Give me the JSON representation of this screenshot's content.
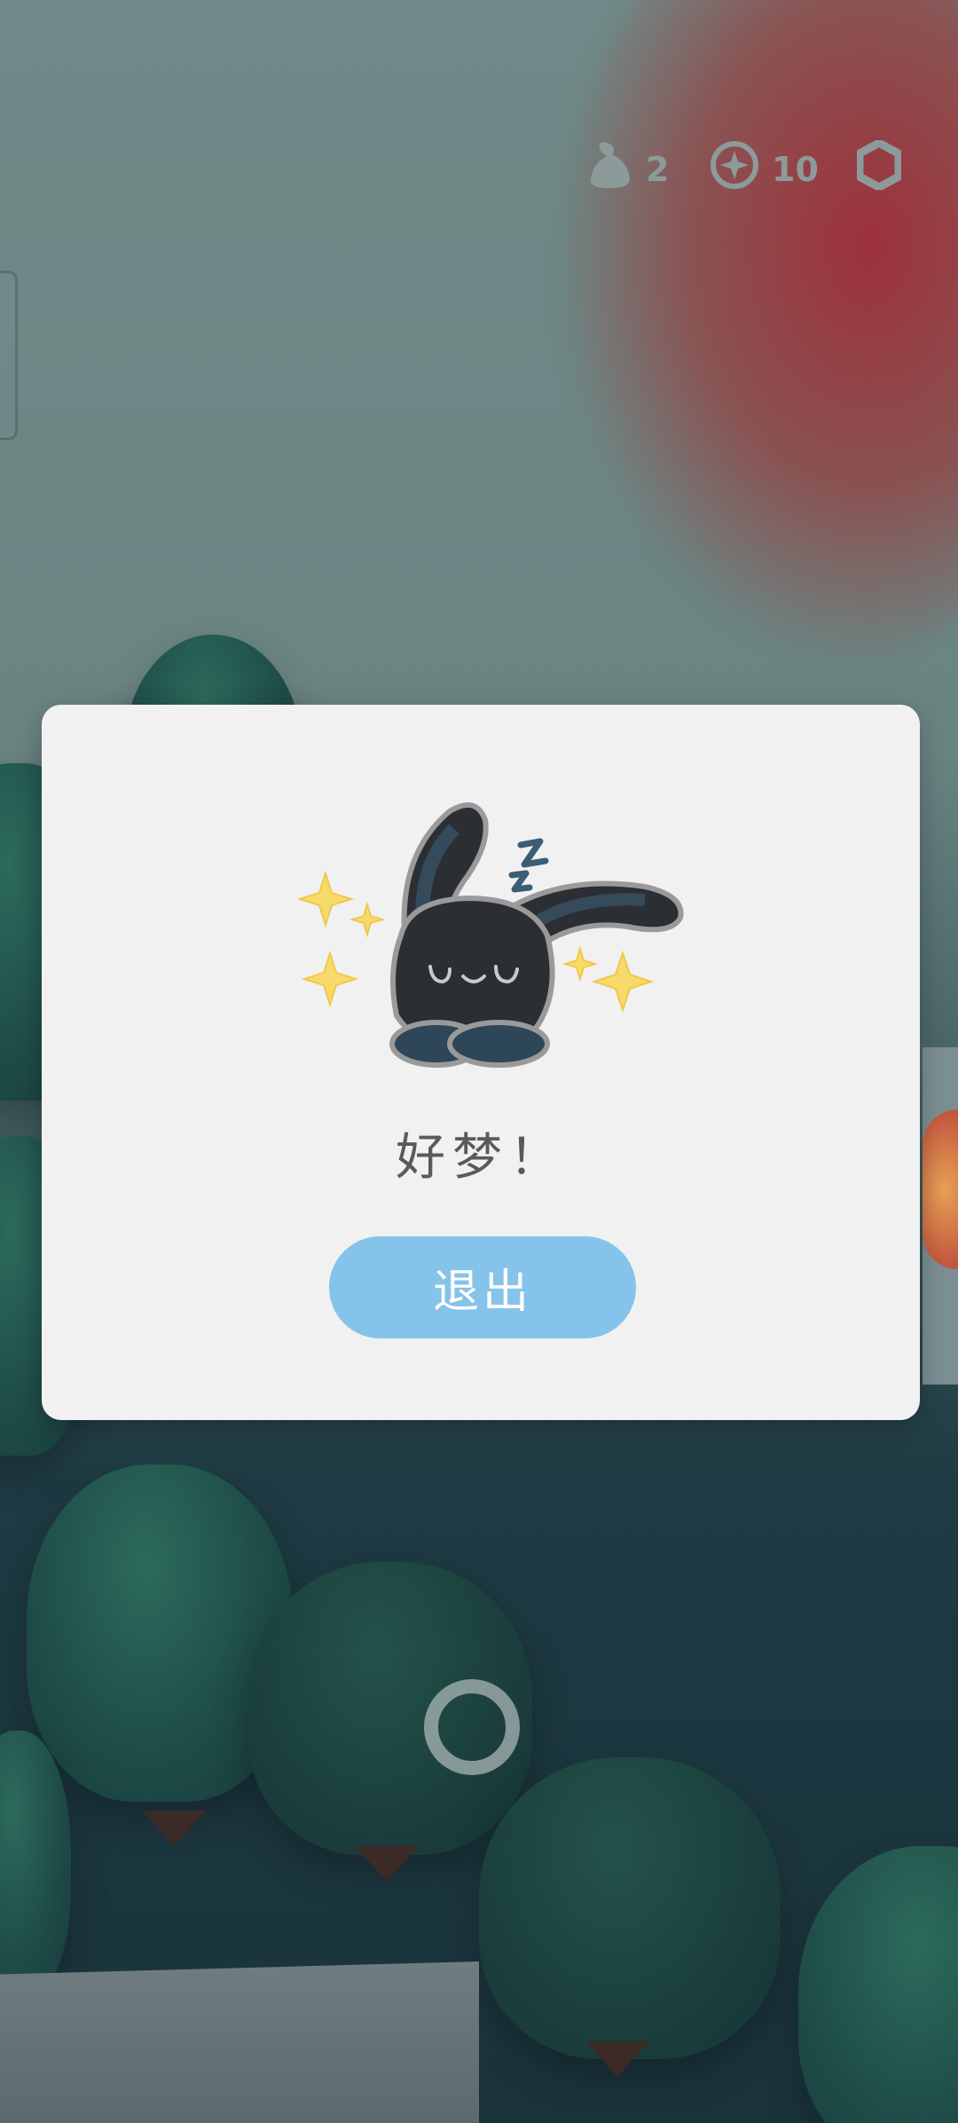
{
  "hud": {
    "bag_count": "2",
    "coin_count": "10",
    "bag_icon": "bag-icon",
    "coin_icon": "compass-coin-icon",
    "settings_icon": "hexagon-settings-icon"
  },
  "dialog": {
    "title": "好梦！",
    "exit_label": "退出",
    "illustration": "sleeping-bunny-illustration"
  },
  "colors": {
    "dialog_bg": "#f1f1f1",
    "button": "#85c3ea",
    "title_text": "#5a5a5a",
    "hud_text": "#8d9a9a"
  }
}
